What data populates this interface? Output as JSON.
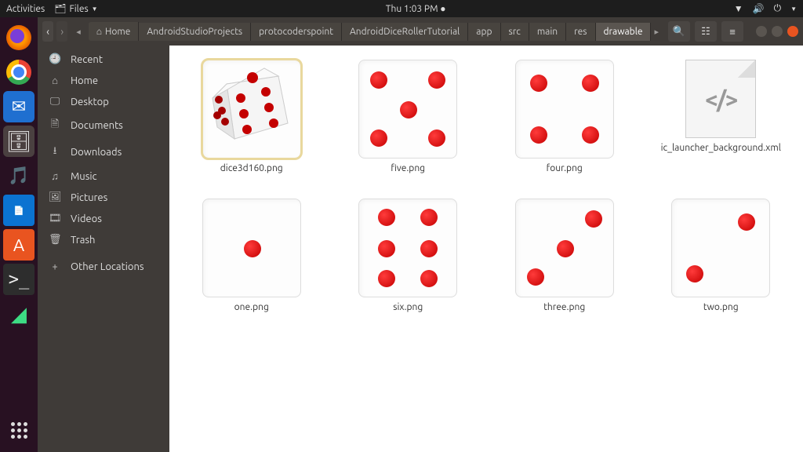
{
  "topbar": {
    "activities": "Activities",
    "appmenu": "Files",
    "clock": "Thu 1:03 PM"
  },
  "breadcrumb": {
    "home": "Home",
    "items": [
      "AndroidStudioProjects",
      "protocoderspoint",
      "AndroidDiceRollerTutorial",
      "app",
      "src",
      "main",
      "res",
      "drawable"
    ]
  },
  "sidebar": {
    "items": [
      {
        "icon": "clock",
        "label": "Recent"
      },
      {
        "icon": "home",
        "label": "Home"
      },
      {
        "icon": "desktop",
        "label": "Desktop"
      },
      {
        "icon": "docs",
        "label": "Documents"
      },
      {
        "icon": "download",
        "label": "Downloads"
      },
      {
        "icon": "music",
        "label": "Music"
      },
      {
        "icon": "pictures",
        "label": "Pictures"
      },
      {
        "icon": "videos",
        "label": "Videos"
      },
      {
        "icon": "trash",
        "label": "Trash"
      },
      {
        "icon": "plus",
        "label": "Other Locations"
      }
    ]
  },
  "files": [
    {
      "name": "dice3d160.png",
      "type": "dice3d"
    },
    {
      "name": "five.png",
      "type": "d5"
    },
    {
      "name": "four.png",
      "type": "d4"
    },
    {
      "name": "ic_launcher_background.xml",
      "type": "xml"
    },
    {
      "name": "one.png",
      "type": "d1"
    },
    {
      "name": "six.png",
      "type": "d6"
    },
    {
      "name": "three.png",
      "type": "d3"
    },
    {
      "name": "two.png",
      "type": "d2"
    }
  ]
}
